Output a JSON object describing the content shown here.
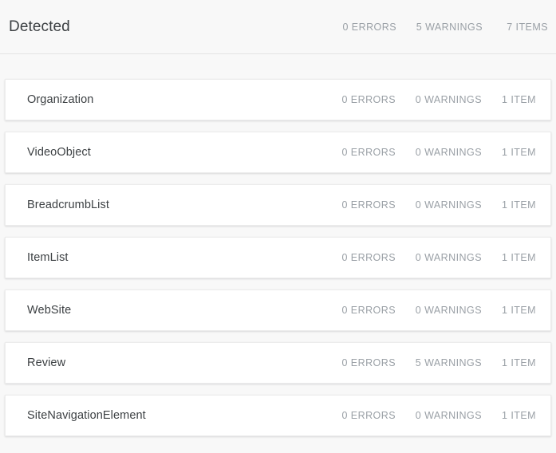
{
  "header": {
    "title": "Detected",
    "errors": "0 ERRORS",
    "warnings": "5 WARNINGS",
    "items": "7 ITEMS",
    "warnings_alert": true
  },
  "colors": {
    "page_background": "#f8f8f8",
    "card_background": "#ffffff",
    "text_primary": "#3c4043",
    "text_muted": "#9aa0a6",
    "alert_orange": "#ef6c00",
    "divider": "#e4e4e4"
  },
  "columns": {
    "errors_header": "ERRORS",
    "warnings_header": "WARNINGS",
    "items_header": "ITEMS"
  },
  "rows": [
    {
      "name": "Organization",
      "errors": "0 ERRORS",
      "warnings": "0 WARNINGS",
      "items": "1 ITEM",
      "warnings_alert": false
    },
    {
      "name": "VideoObject",
      "errors": "0 ERRORS",
      "warnings": "0 WARNINGS",
      "items": "1 ITEM",
      "warnings_alert": false
    },
    {
      "name": "BreadcrumbList",
      "errors": "0 ERRORS",
      "warnings": "0 WARNINGS",
      "items": "1 ITEM",
      "warnings_alert": false
    },
    {
      "name": "ItemList",
      "errors": "0 ERRORS",
      "warnings": "0 WARNINGS",
      "items": "1 ITEM",
      "warnings_alert": false
    },
    {
      "name": "WebSite",
      "errors": "0 ERRORS",
      "warnings": "0 WARNINGS",
      "items": "1 ITEM",
      "warnings_alert": false
    },
    {
      "name": "Review",
      "errors": "0 ERRORS",
      "warnings": "5 WARNINGS",
      "items": "1 ITEM",
      "warnings_alert": true
    },
    {
      "name": "SiteNavigationElement",
      "errors": "0 ERRORS",
      "warnings": "0 WARNINGS",
      "items": "1 ITEM",
      "warnings_alert": false
    }
  ]
}
